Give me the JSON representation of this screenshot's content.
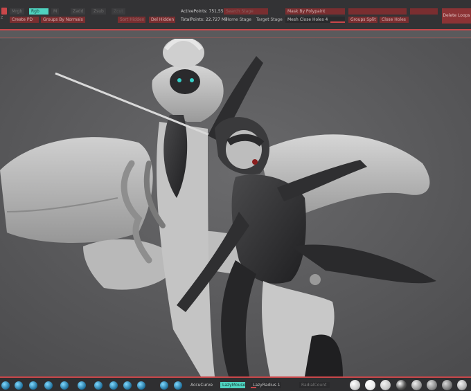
{
  "toolbar": {
    "mrgb": "Mrgb",
    "rgb": "Rgb",
    "m": "M",
    "zadd": "Zadd",
    "zsub": "Zsub",
    "zcut": "Zcut",
    "create_pd": "Create PD",
    "groups_by_normals": "Groups By Normals",
    "sort_hidden": "Sort Hidden",
    "del_hidden": "Del Hidden",
    "active_points": "ActivePoints: 751,558",
    "total_points": "TotalPoints: 22.727 Mil",
    "search_stage": "Search Stage",
    "home_stage": "Home Stage",
    "target_stage": "Target Stage",
    "mask_by_polypaint": "Mask By Polypaint",
    "mesh_close_holes": "Mesh Close Holes",
    "mesh_close_holes_value": "4",
    "mesh_close_holes_fill": 0.25,
    "dynamic_subdiv": "Dyn Subdiv",
    "groups_split": "Groups Split",
    "close_holes": "Close Holes",
    "delete_loops": "Delete Loops"
  },
  "bottombar": {
    "accucurve": "AccuCurve",
    "lazymouse": "LazyMouse",
    "lazyradius": "LazyRadius",
    "lazyradius_value": "1",
    "radial_count": "RadialCount"
  },
  "colors": {
    "accent": "#c9474a",
    "teal": "#4fd3c0",
    "bar": "#333335",
    "canvas": "#5a5a5c"
  },
  "icons": [
    "brush-icon",
    "material-sphere-icon"
  ]
}
